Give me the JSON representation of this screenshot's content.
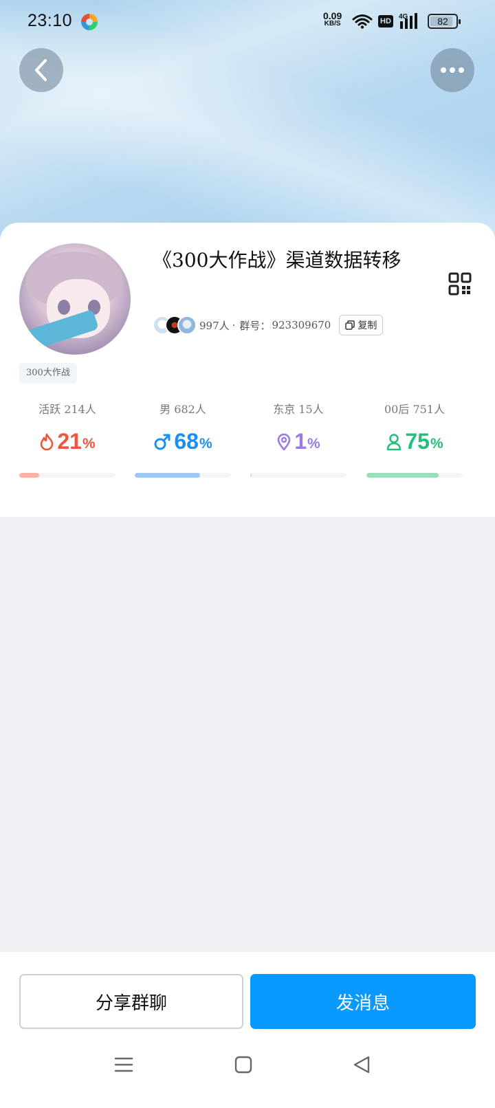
{
  "status_bar": {
    "time": "23:10",
    "net_speed_value": "0.09",
    "net_speed_unit": "KB/S",
    "hd_label": "HD",
    "signal_label": "4G",
    "battery": "82"
  },
  "header": {
    "back_icon": "chevron-left-icon",
    "more_icon": "more-horizontal-icon"
  },
  "group": {
    "name": "《300大作战》渠道数据转移",
    "member_count_text": "997人",
    "separator": "·",
    "group_id_label": "群号：",
    "group_id": "923309670",
    "copy_label": "复制",
    "tag": "300大作战",
    "qr_icon": "qr-code-icon"
  },
  "stats": [
    {
      "label": "活跃 214人",
      "value": "21",
      "unit": "%",
      "icon": "flame-icon",
      "color": "#f0553c",
      "fraction": 0.21
    },
    {
      "label": "男 682人",
      "value": "68",
      "unit": "%",
      "icon": "male-icon",
      "color": "#1a8ff0",
      "fraction": 0.68
    },
    {
      "label": "东京 15人",
      "value": "1",
      "unit": "%",
      "icon": "location-pin-icon",
      "color": "#9b7be3",
      "fraction": 0.01
    },
    {
      "label": "00后 751人",
      "value": "75",
      "unit": "%",
      "icon": "person-icon",
      "color": "#22c07a",
      "fraction": 0.75
    }
  ],
  "actions": {
    "share_label": "分享群聊",
    "send_label": "发消息"
  },
  "nav": {
    "menu_icon": "menu-icon",
    "home_icon": "square-home-icon",
    "back_icon": "triangle-back-icon"
  },
  "colors": {
    "accent": "#0a99ff",
    "active_bar": "#f9b3a6",
    "male_bar": "#9ec9f6",
    "location_bar": "#d9d2f4",
    "age_bar": "#99dfbc"
  }
}
